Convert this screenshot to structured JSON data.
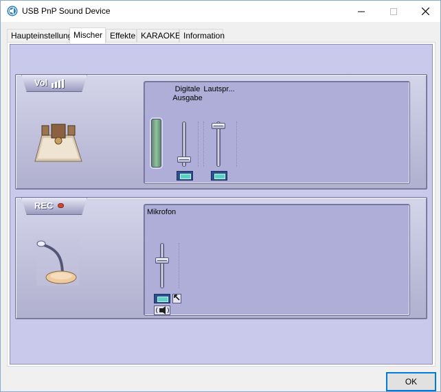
{
  "window": {
    "title": "USB PnP Sound Device",
    "icon": "speaker-app-icon"
  },
  "tabs": [
    {
      "label": "Haupteinstellung",
      "active": false
    },
    {
      "label": "Mischer",
      "active": true
    },
    {
      "label": "Effekte",
      "active": false
    },
    {
      "label": "KARAOKE",
      "active": false
    },
    {
      "label": "Information",
      "active": false
    }
  ],
  "playback": {
    "header": "Vol",
    "channels": [
      {
        "label": "Digitale Ausgabe",
        "slider_level": 0.08,
        "meter": "level-meter"
      },
      {
        "label": "Lautspr...",
        "slider_level": 0.96
      }
    ]
  },
  "record": {
    "header": "REC",
    "channels": [
      {
        "label": "Mikrofon",
        "slider_level": 0.62
      }
    ]
  },
  "footer": {
    "ok_label": "OK"
  },
  "colors": {
    "panel_bg": "#c9c9ec",
    "section_bg": "#b0b0cf",
    "inner_bg": "#aeaed8",
    "mute_button": "#2b4f90",
    "mute_indicator": "#59d3c8",
    "ok_border": "#0078d7",
    "rec_led": "#d0462e"
  }
}
